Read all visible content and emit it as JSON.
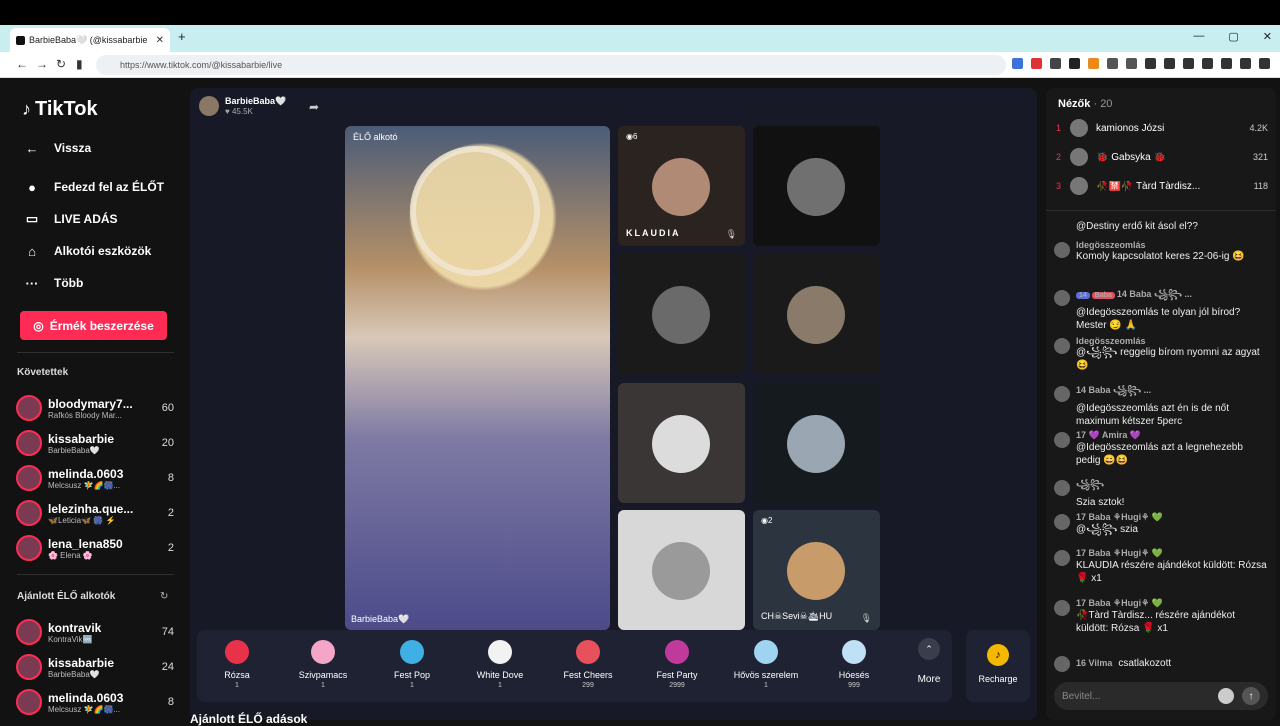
{
  "browser": {
    "tab_title": "BarbieBaba🤍 (@kissabarbie",
    "new_tab": "+",
    "url": "https://www.tiktok.com/@kissabarbie/live",
    "window_controls": [
      "—",
      "▢",
      "✕"
    ]
  },
  "sidebar": {
    "logo": "TikTok",
    "nav": [
      {
        "label": "Vissza",
        "icon": "←"
      },
      {
        "label": "Fedezd fel az ÉLŐT",
        "icon": "●"
      },
      {
        "label": "LIVE ADÁS",
        "icon": "▭"
      },
      {
        "label": "Alkotói eszközök",
        "icon": "⌂"
      },
      {
        "label": "Több",
        "icon": "···"
      }
    ],
    "coins_button": "Érmék beszerzése",
    "following_title": "Követettek",
    "following": [
      {
        "name": "bloodymary7...",
        "sub": "Rafkós Bloody Mar...",
        "count": "60"
      },
      {
        "name": "kissabarbie",
        "sub": "BarbieBaba🤍",
        "count": "20"
      },
      {
        "name": "melinda.0603",
        "sub": "Melcsusz 🧚🌈🎆...",
        "count": "8"
      },
      {
        "name": "lelezinha.que...",
        "sub": "🦋Leticia🦋 🎆 ⚡",
        "count": "2"
      },
      {
        "name": "lena_lena850",
        "sub": "🌸 Elena 🌸",
        "count": "2"
      }
    ],
    "recommended_title": "Ajánlott ÉLŐ alkotók",
    "recommended": [
      {
        "name": "kontravik",
        "sub": "KontraVik🆒",
        "count": "74"
      },
      {
        "name": "kissabarbie",
        "sub": "BarbieBaba🤍",
        "count": "24"
      },
      {
        "name": "melinda.0603",
        "sub": "Melcsusz 🧚🌈🎆...",
        "count": "8"
      }
    ]
  },
  "stage": {
    "host_name": "BarbieBaba🤍",
    "host_likes": "♥ 45.5K",
    "main_label": "ÉLŐ alkotó",
    "main_name": "BarbieBaba🤍",
    "tiles": [
      {
        "name": "KLAUDIA",
        "badge": "◉6",
        "color": "#b08a74"
      },
      {
        "name": "",
        "badge": "",
        "color": "#d0d0d0"
      },
      {
        "name": "",
        "badge": "",
        "color": "#6a6a6a"
      },
      {
        "name": "",
        "badge": "",
        "color": "#8a7a6a"
      },
      {
        "name": "",
        "badge": "",
        "color": "#dcdcdc"
      },
      {
        "name": "",
        "badge": "",
        "color": "#9aa7b2"
      },
      {
        "name": "",
        "badge": "",
        "color": "#cccccc"
      },
      {
        "name": "CH☠Sevi☠🛳HU",
        "badge": "◉2",
        "color": "#c89b6a"
      }
    ],
    "gifts": [
      {
        "name": "Rózsa",
        "price": "1",
        "color": "#e8324a"
      },
      {
        "name": "Szivpamacs",
        "price": "1",
        "color": "#f4a5c8"
      },
      {
        "name": "Fest Pop",
        "price": "1",
        "color": "#3fb0e6"
      },
      {
        "name": "White Dove",
        "price": "1",
        "color": "#f2f2f2"
      },
      {
        "name": "Fest Cheers",
        "price": "299",
        "color": "#e8505b"
      },
      {
        "name": "Fest Party",
        "price": "2999",
        "color": "#c03a9b"
      },
      {
        "name": "Hővös szerelem",
        "price": "1",
        "color": "#9fd4f0"
      },
      {
        "name": "Hóesés",
        "price": "999",
        "color": "#bfe0f5"
      }
    ],
    "more": "More",
    "recharge": "Recharge",
    "below_title": "Ajánlott ÉLŐ adások"
  },
  "chat": {
    "viewers_title": "Nézők",
    "viewers_count": "· 20",
    "viewers": [
      {
        "rank": "1",
        "name": "kamionos Józsi",
        "score": "4.2K"
      },
      {
        "rank": "2",
        "name": "🐞 Gabsyka 🐞",
        "score": "321"
      },
      {
        "rank": "3",
        "name": "🥀🈲🥀 Tàrd Tàrdisz...",
        "score": "118"
      }
    ],
    "messages": [
      {
        "user": "",
        "text": "@Destiny erdő kit ásol el??"
      },
      {
        "user": "Idegösszeomlás",
        "text": "Komoly kapcsolatot keres 22-06-ig 😆"
      },
      {
        "user": "14  Baba  ꧁꧂ ...",
        "text": "@Idegösszeomlás te olyan jól bírod? Mester 😏 🙏"
      },
      {
        "user": "Idegösszeomlás",
        "text": "@꧁꧂ reggelig bírom nyomni az agyat 😆"
      },
      {
        "user": "14  Baba  ꧁꧂ ...",
        "text": "@Idegösszeomlás azt én is de nőt maximum kétszer 5perc"
      },
      {
        "user": "17  💜 Amira 💜",
        "text": "@Idegösszeomlás azt a legnehezebb pedig 😄😆"
      },
      {
        "user": "꧁꧂",
        "text": "Szia sztok!"
      },
      {
        "user": "17  Baba  ⚘Hugi⚘ 💚",
        "text": "@꧁꧂ szia"
      },
      {
        "user": "17  Baba  ⚘Hugi⚘ 💚",
        "text": "KLAUDIA részére ajándékot küldött: Rózsa 🌹 x1"
      },
      {
        "user": "17  Baba  ⚘Hugi⚘ 💚",
        "text": "🥀Tàrd Tàrdisz... részére ajándékot küldött: Rózsa 🌹 x1"
      },
      {
        "user": "16  Vilma",
        "text": "csatlakozott"
      }
    ],
    "input_placeholder": "Bevitel..."
  }
}
